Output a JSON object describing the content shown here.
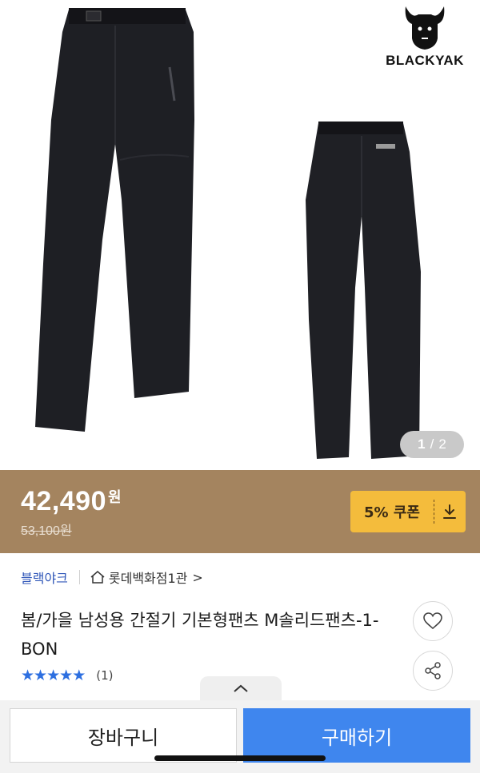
{
  "logo": {
    "wordmark": "BLACKYAK"
  },
  "gallery": {
    "current": "1",
    "separator": "/",
    "total": "2"
  },
  "price": {
    "amount": "42,490",
    "unit": "원",
    "original": "53,100원"
  },
  "coupon": {
    "label": "5% 쿠폰",
    "icon": "download-icon"
  },
  "brand": {
    "name": "블랙야크",
    "store": "롯데백화점1관",
    "store_icon": "home-icon",
    "chevron": ">"
  },
  "product": {
    "title": "봄/가을 남성용 간절기 기본형팬츠 M솔리드팬츠-1-BON"
  },
  "rating": {
    "stars": 5,
    "count": "(1)"
  },
  "actions": {
    "wishlist_icon": "heart-icon",
    "share_icon": "share-icon",
    "expand_icon": "chevron-up-icon"
  },
  "buttons": {
    "cart": "장바구니",
    "buy": "구매하기"
  },
  "colors": {
    "price_bar": "#a4845f",
    "coupon": "#f4bc3c",
    "buy": "#3f86ee",
    "brand_link": "#2f56b8",
    "stars": "#2d6fe0"
  }
}
